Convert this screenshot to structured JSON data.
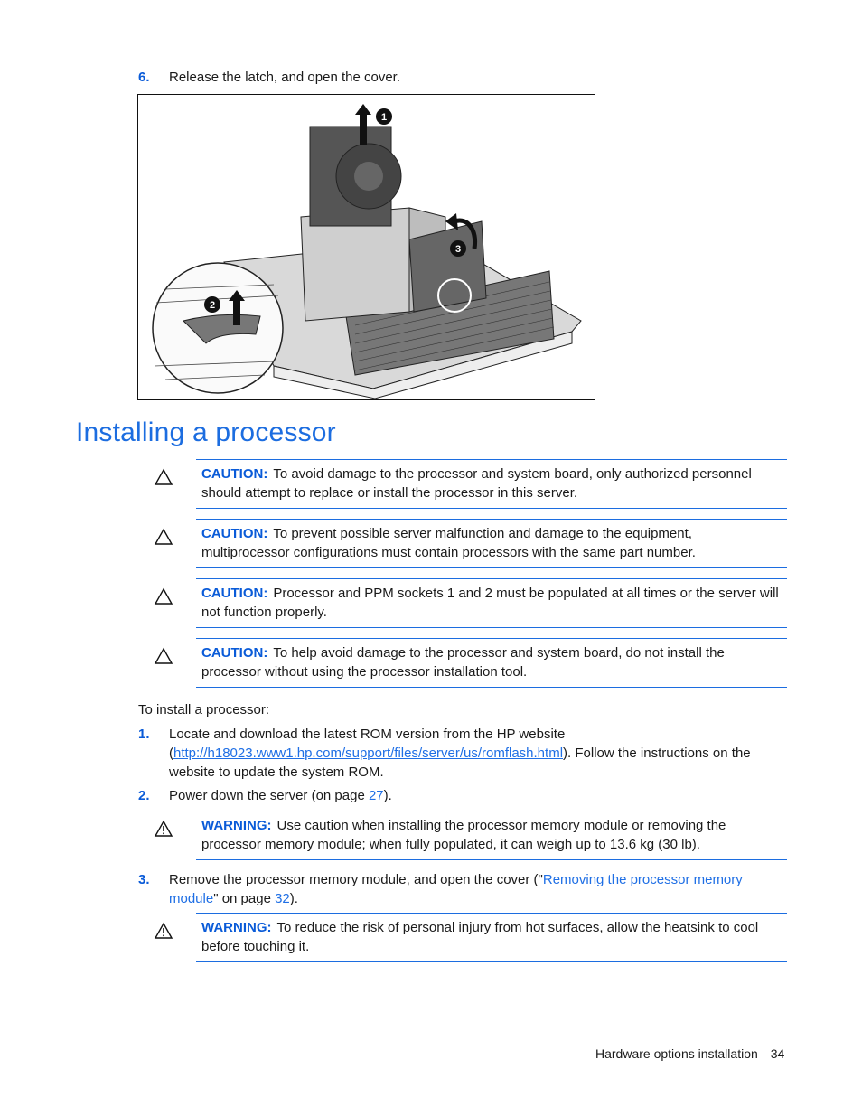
{
  "step6": {
    "number": "6.",
    "text": "Release the latch, and open the cover."
  },
  "figure": {
    "description": "Processor memory module with fan assembly lifted, latch released and cover opened",
    "callouts": [
      "1",
      "2",
      "3"
    ]
  },
  "section_title": "Installing a processor",
  "cautions": [
    {
      "label": "CAUTION:",
      "icon": "caution-triangle-icon",
      "text": "To avoid damage to the processor and system board, only authorized personnel should attempt to replace or install the processor in this server."
    },
    {
      "label": "CAUTION:",
      "icon": "caution-triangle-icon",
      "text": "To prevent possible server malfunction and damage to the equipment, multiprocessor configurations must contain processors with the same part number."
    },
    {
      "label": "CAUTION:",
      "icon": "caution-triangle-icon",
      "text": "Processor and PPM sockets 1 and 2 must be populated at all times or the server will not function properly."
    },
    {
      "label": "CAUTION:",
      "icon": "caution-triangle-icon",
      "text": "To help avoid damage to the processor and system board, do not install the processor without using the processor installation tool."
    }
  ],
  "intro": "To install a processor:",
  "steps": [
    {
      "number": "1.",
      "text_before": "Locate and download the latest ROM version from the HP website (",
      "link": "http://h18023.www1.hp.com/support/files/server/us/romflash.html",
      "text_after": "). Follow the instructions on the website to update the system ROM."
    },
    {
      "number": "2.",
      "text_before": "Power down the server (on page ",
      "page_link": "27",
      "text_after": ")."
    },
    {
      "number": "3.",
      "text_before": "Remove the processor memory module, and open the cover (\"",
      "link": "Removing the processor memory module",
      "text_middle": "\" on page ",
      "page_link": "32",
      "text_after": ")."
    }
  ],
  "warnings": [
    {
      "label": "WARNING:",
      "icon": "warning-exclamation-icon",
      "text": "Use caution when installing the processor memory module or removing the processor memory module; when fully populated, it can weigh up to 13.6 kg (30 lb)."
    },
    {
      "label": "WARNING:",
      "icon": "warning-exclamation-icon",
      "text": "To reduce the risk of personal injury from hot surfaces, allow the heatsink to cool before touching it."
    }
  ],
  "footer": {
    "section": "Hardware options installation",
    "page": "34"
  }
}
